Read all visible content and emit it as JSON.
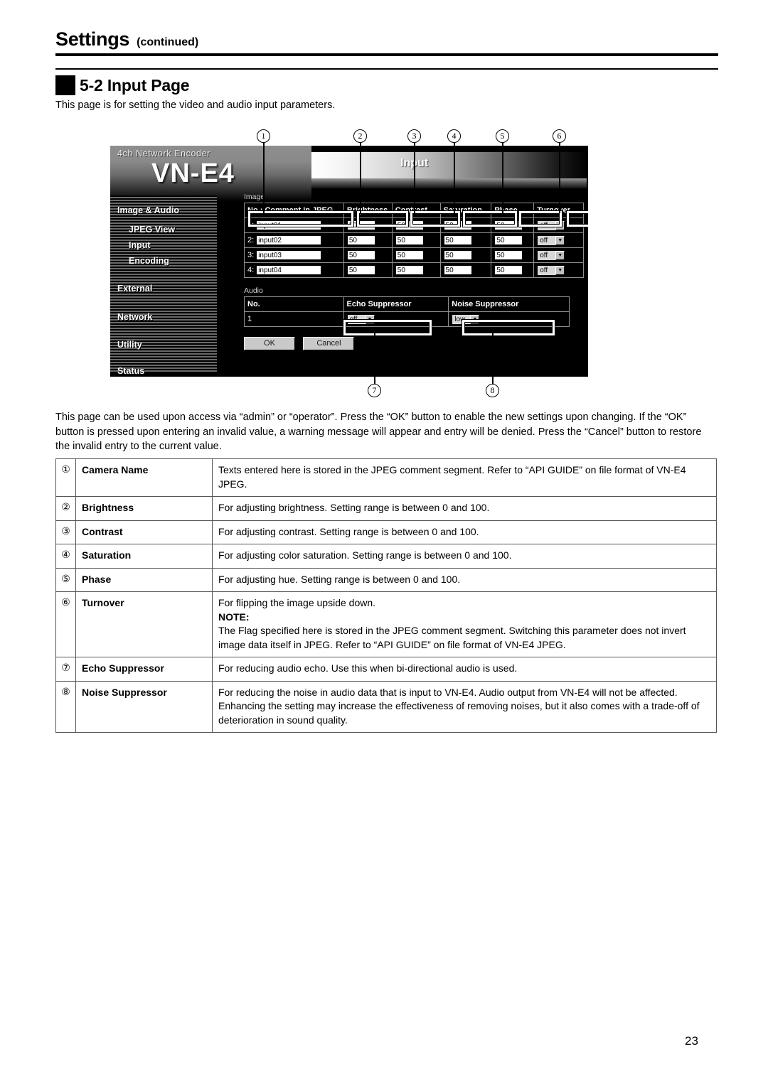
{
  "page": {
    "header_title": "Settings",
    "header_suffix": "(continued)",
    "section_title": "5-2 Input Page",
    "lead": "This page is for setting the video and audio input parameters.",
    "page_number": "23",
    "body_paragraph": "This page can be used upon access via “admin” or “operator”. Press the “OK” button to enable the new settings upon changing. If the “OK” button is pressed upon entering an invalid value, a warning message will appear and entry will be denied. Press the “Cancel” button to restore the invalid entry to the current value."
  },
  "device_ui": {
    "logo_sub": "4ch Network Encoder",
    "logo_main": "VN-E4",
    "page_header_title": "Input",
    "nav": [
      {
        "label": "Image & Audio",
        "level": 1
      },
      {
        "label": "JPEG View",
        "level": 2
      },
      {
        "label": "Input",
        "level": 2
      },
      {
        "label": "Encoding",
        "level": 2
      },
      {
        "label": "External",
        "level": 1
      },
      {
        "label": "Network",
        "level": 1
      },
      {
        "label": "Utility",
        "level": 1
      },
      {
        "label": "Status",
        "level": 1
      }
    ],
    "image_section": {
      "caption": "Image",
      "columns": [
        "No.: Comment in JPEG",
        "Brightness",
        "Contrast",
        "Saturation",
        "Phase",
        "Turnover"
      ],
      "rows": [
        {
          "no": "1:",
          "comment": "input01",
          "brightness": "50",
          "contrast": "50",
          "saturation": "50",
          "phase": "50",
          "turnover": "off"
        },
        {
          "no": "2:",
          "comment": "input02",
          "brightness": "50",
          "contrast": "50",
          "saturation": "50",
          "phase": "50",
          "turnover": "off"
        },
        {
          "no": "3:",
          "comment": "input03",
          "brightness": "50",
          "contrast": "50",
          "saturation": "50",
          "phase": "50",
          "turnover": "off"
        },
        {
          "no": "4:",
          "comment": "input04",
          "brightness": "50",
          "contrast": "50",
          "saturation": "50",
          "phase": "50",
          "turnover": "off"
        }
      ]
    },
    "audio_section": {
      "caption": "Audio",
      "columns": [
        "No.",
        "Echo Suppressor",
        "Noise Suppressor"
      ],
      "rows": [
        {
          "no": "1",
          "echo_suppressor": "off",
          "noise_suppressor": "low"
        }
      ]
    },
    "buttons": {
      "ok": "OK",
      "cancel": "Cancel"
    }
  },
  "callouts": [
    "1",
    "2",
    "3",
    "4",
    "5",
    "6",
    "7",
    "8"
  ],
  "descriptions": [
    {
      "num": "1",
      "name": "Camera Name",
      "text": "Texts entered here is stored in the JPEG comment segment. Refer to “API GUIDE” on file format of VN-E4 JPEG."
    },
    {
      "num": "2",
      "name": "Brightness",
      "text": "For adjusting brightness. Setting range is between 0 and 100."
    },
    {
      "num": "3",
      "name": "Contrast",
      "text": "For adjusting contrast. Setting range is between 0 and 100."
    },
    {
      "num": "4",
      "name": "Saturation",
      "text": "For adjusting color saturation. Setting range is between 0 and 100."
    },
    {
      "num": "5",
      "name": "Phase",
      "text": "For adjusting hue. Setting range is between 0 and 100."
    },
    {
      "num": "6",
      "name": "Turnover",
      "text": "For flipping the image upside down.",
      "note_label": "NOTE:",
      "note_text": "The Flag specified here is stored in the JPEG comment segment. Switching this parameter does not invert image data itself in JPEG. Refer to “API GUIDE” on file format of VN-E4 JPEG."
    },
    {
      "num": "7",
      "name": "Echo Suppressor",
      "text": "For reducing audio echo. Use this when bi-directional audio is used."
    },
    {
      "num": "8",
      "name": "Noise Suppressor",
      "text": "For reducing the noise in audio data that is input to VN-E4. Audio output from VN-E4 will not be affected. Enhancing the setting may increase the effectiveness of removing noises, but it also comes with a trade-off of deterioration in sound quality."
    }
  ]
}
